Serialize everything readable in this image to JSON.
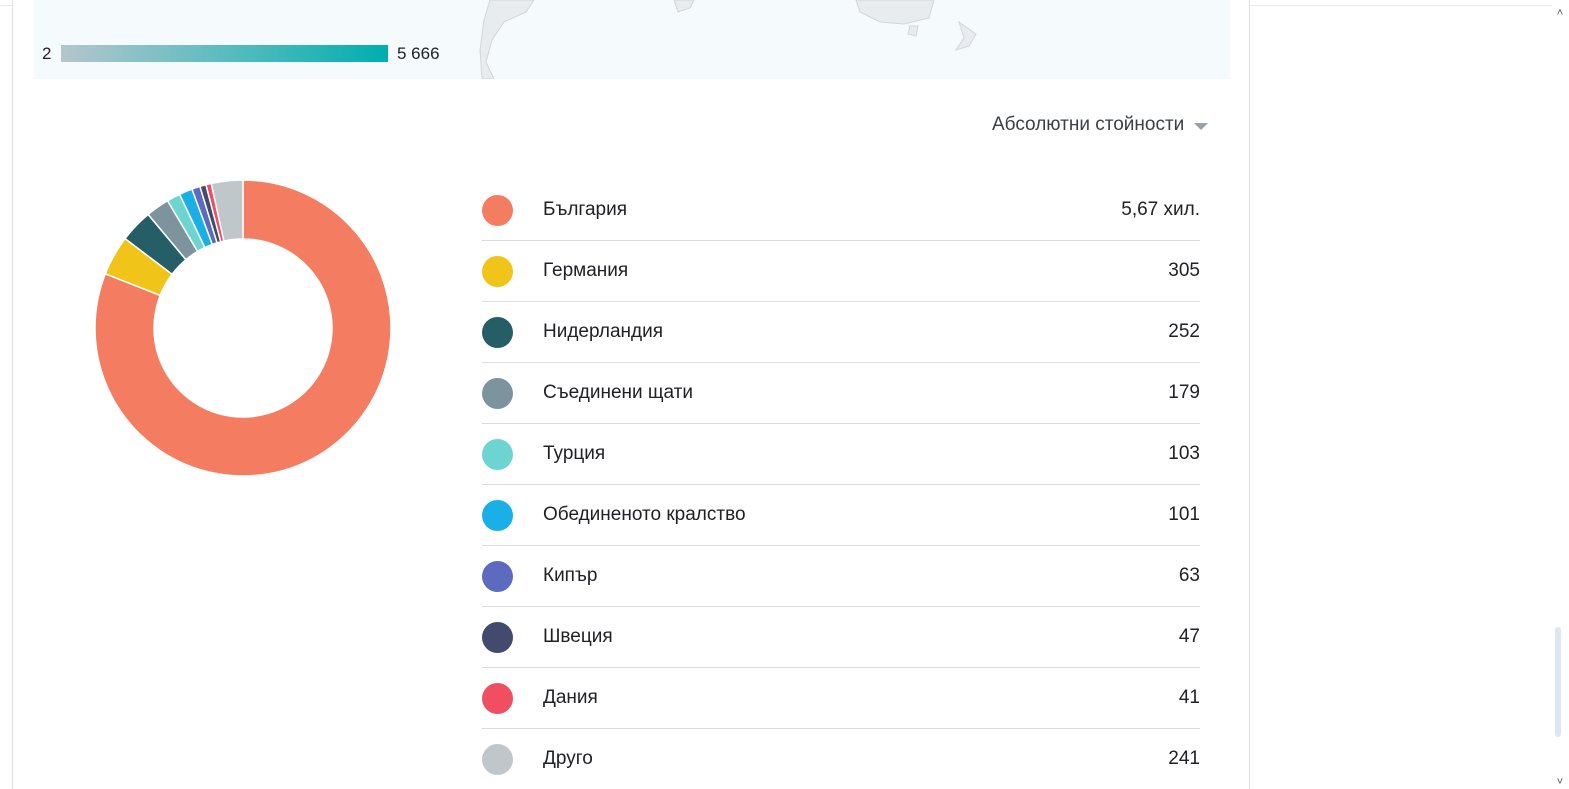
{
  "scale": {
    "min_label": "2",
    "max_label": "5 666"
  },
  "metric_selector": {
    "label": "Абсолютни стойности",
    "icon": "caret-down-icon"
  },
  "chart_data": {
    "type": "pie",
    "style": "donut",
    "categories": [
      "България",
      "Германия",
      "Нидерландия",
      "Съединени щати",
      "Турция",
      "Обединеното кралство",
      "Кипър",
      "Швеция",
      "Дания",
      "Друго"
    ],
    "values": [
      5666,
      305,
      252,
      179,
      103,
      101,
      63,
      47,
      41,
      241
    ],
    "colors": [
      "#f47c60",
      "#f0c419",
      "#265e67",
      "#7d939e",
      "#6dd5d1",
      "#1aafe6",
      "#5c6bc0",
      "#424a6e",
      "#ef4f61",
      "#c0c7cb"
    ]
  },
  "legend": {
    "rows": [
      {
        "country": "България",
        "value": "5,67 хил.",
        "color": "#f47c60"
      },
      {
        "country": "Германия",
        "value": "305",
        "color": "#f0c419"
      },
      {
        "country": "Нидерландия",
        "value": "252",
        "color": "#265e67"
      },
      {
        "country": "Съединени щати",
        "value": "179",
        "color": "#7d939e"
      },
      {
        "country": "Турция",
        "value": "103",
        "color": "#6dd5d1"
      },
      {
        "country": "Обединеното кралство",
        "value": "101",
        "color": "#1aafe6"
      },
      {
        "country": "Кипър",
        "value": "63",
        "color": "#5c6bc0"
      },
      {
        "country": "Швеция",
        "value": "47",
        "color": "#424a6e"
      },
      {
        "country": "Дания",
        "value": "41",
        "color": "#ef4f61"
      },
      {
        "country": "Друго",
        "value": "241",
        "color": "#c0c7cb"
      }
    ]
  }
}
